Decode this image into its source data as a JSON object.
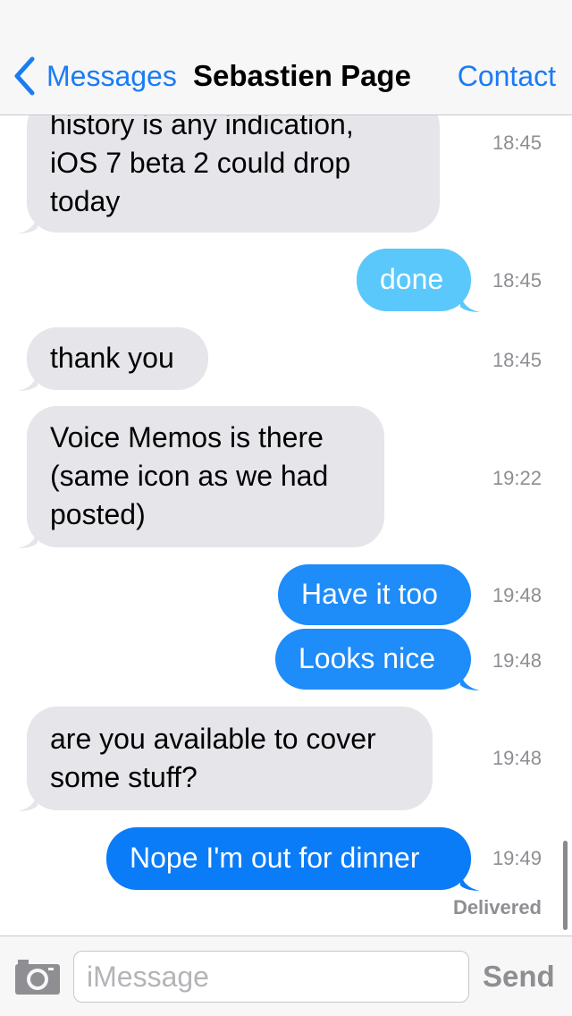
{
  "header": {
    "back_label": "Messages",
    "title": "Sebastien Page",
    "contact_label": "Contact"
  },
  "messages": [
    {
      "direction": "incoming",
      "lines": [
        "history is any indication,",
        "iOS 7 beta 2 could drop",
        "today"
      ],
      "time": "18:45"
    },
    {
      "direction": "outgoing",
      "lines": [
        "done"
      ],
      "time": "18:45"
    },
    {
      "direction": "incoming",
      "lines": [
        "thank you"
      ],
      "time": "18:45"
    },
    {
      "direction": "incoming",
      "lines": [
        "Voice Memos is there",
        "(same icon as we had",
        "posted)"
      ],
      "time": "19:22"
    },
    {
      "direction": "outgoing",
      "lines": [
        "Have it too"
      ],
      "time": "19:48"
    },
    {
      "direction": "outgoing",
      "lines": [
        "Looks nice"
      ],
      "time": "19:48"
    },
    {
      "direction": "incoming",
      "lines": [
        "are you available to cover",
        "some stuff?"
      ],
      "time": "19:48"
    },
    {
      "direction": "outgoing",
      "lines": [
        "Nope I'm out for dinner"
      ],
      "time": "19:49"
    }
  ],
  "delivered_label": "Delivered",
  "input": {
    "placeholder": "iMessage",
    "value": ""
  },
  "send_label": "Send",
  "icons": {
    "back": "chevron-left-icon",
    "camera": "camera-icon"
  },
  "colors": {
    "accent": "#1a7cf4",
    "incoming_bubble": "#e5e5ea",
    "outgoing_bubble": "#1e8cf9",
    "outgoing_bubble_light": "#5ac8fa",
    "timestamp": "#8e8e93"
  }
}
